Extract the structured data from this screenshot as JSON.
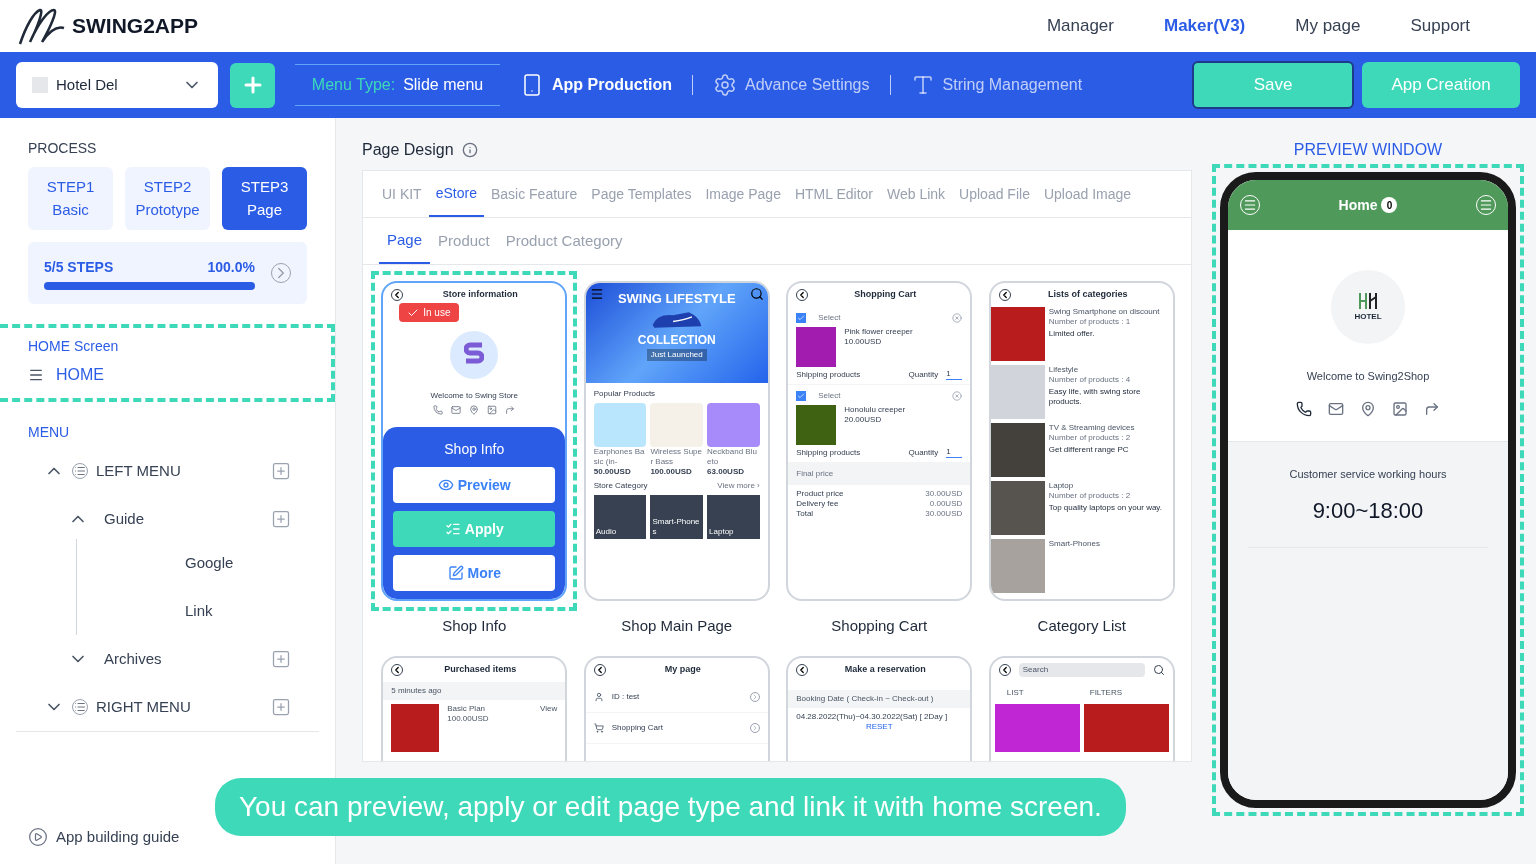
{
  "header": {
    "brand": "SWING2APP",
    "nav": [
      {
        "label": "Manager",
        "selected": false
      },
      {
        "label": "Maker(V3)",
        "selected": true
      },
      {
        "label": "My page",
        "selected": false
      },
      {
        "label": "Support",
        "selected": false
      }
    ]
  },
  "toolbar": {
    "project": "Hotel Del",
    "menu_type_label": "Menu Type:",
    "menu_type_value": "Slide menu",
    "tools": [
      {
        "kind": "production",
        "label": "App Production",
        "selected": true
      },
      {
        "kind": "settings",
        "label": "Advance Settings",
        "selected": false
      },
      {
        "kind": "strings",
        "label": "String Management",
        "selected": false
      }
    ],
    "save": "Save",
    "create": "App Creation"
  },
  "sidebar": {
    "process_title": "PROCESS",
    "steps": [
      {
        "line1": "STEP1",
        "line2": "Basic",
        "selected": false
      },
      {
        "line1": "STEP2",
        "line2": "Prototype",
        "selected": false
      },
      {
        "line1": "STEP3",
        "line2": "Page",
        "selected": true
      }
    ],
    "progress": {
      "label": "5/5 STEPS",
      "percent": "100.0%",
      "level": 1
    },
    "home_title": "HOME Screen",
    "home_item": "HOME",
    "menu_title": "MENU",
    "tree": [
      {
        "label": "LEFT MENU",
        "expanded": true,
        "children": [
          {
            "label": "Guide",
            "expanded": true,
            "children": [
              {
                "label": "Google"
              },
              {
                "label": "Link"
              }
            ]
          },
          {
            "label": "Archives",
            "expanded": false
          }
        ]
      },
      {
        "label": "RIGHT MENU",
        "expanded": false
      }
    ],
    "guide": "App building guide"
  },
  "main": {
    "title": "Page Design",
    "tabs": [
      {
        "label": "UI KIT",
        "selected": false
      },
      {
        "label": "eStore",
        "selected": true
      },
      {
        "label": "Basic Feature",
        "selected": false
      },
      {
        "label": "Page Templates",
        "selected": false
      },
      {
        "label": "Image Page",
        "selected": false
      },
      {
        "label": "HTML Editor",
        "selected": false
      },
      {
        "label": "Web Link",
        "selected": false
      },
      {
        "label": "Upload File",
        "selected": false
      },
      {
        "label": "Upload Image",
        "selected": false
      }
    ],
    "subtabs": [
      {
        "label": "Page",
        "selected": true
      },
      {
        "label": "Product",
        "selected": false
      },
      {
        "label": "Product Category",
        "selected": false
      }
    ],
    "templates": [
      {
        "kind": "shop_info",
        "caption": "Shop Info",
        "selected": true,
        "in_use": true,
        "badge": "In use",
        "title": "Store information",
        "welcome": "Welcome to Swing Store",
        "overlay_title": "Shop Info",
        "actions": [
          "Preview",
          "Apply",
          "More"
        ]
      },
      {
        "kind": "main",
        "caption": "Shop Main Page",
        "selected": false,
        "in_use": false,
        "banner_title": "SWING LIFESTYLE",
        "banner_sub": "COLLECTION",
        "banner_note": "Just Launched",
        "section1": "Popular Products",
        "products": [
          {
            "name": "Earphones Basic (in-",
            "price": "50.00USD"
          },
          {
            "name": "Wireless Super Bass",
            "price": "100.00USD"
          },
          {
            "name": "Neckband Blueto",
            "price": "63.00USD"
          }
        ],
        "section2": "Store Category",
        "more": "View more ›",
        "categories": [
          "Audio",
          "Smart-Phones",
          "Laptop"
        ]
      },
      {
        "kind": "cart",
        "caption": "Shopping Cart",
        "selected": false,
        "in_use": false,
        "title": "Shopping Cart",
        "items": [
          {
            "select": "Select",
            "checked": true,
            "name": "Pink flower creeper",
            "price": "10.00USD",
            "group": "Shipping products",
            "qty_label": "Quantity",
            "qty": "1"
          },
          {
            "select": "Select",
            "checked": true,
            "name": "Honolulu creeper",
            "price": "20.00USD",
            "group": "Shipping products",
            "qty_label": "Quantity",
            "qty": "1"
          }
        ],
        "final": "Final price",
        "lines": [
          {
            "label": "Product price",
            "value": "30.00USD"
          },
          {
            "label": "Delivery fee",
            "value": "0.00USD"
          },
          {
            "label": "Total",
            "value": "30.00USD"
          }
        ]
      },
      {
        "kind": "categories",
        "caption": "Category List",
        "selected": false,
        "in_use": false,
        "title": "Lists of categories",
        "items": [
          {
            "name": "Swing Smartphone on discount",
            "count": "Number of products : 1",
            "desc": "Limited offer."
          },
          {
            "name": "Lifestyle",
            "count": "Number of products : 4",
            "desc": "Easy life, with swing store products."
          },
          {
            "name": "TV & Streaming devices",
            "count": "Number of products : 2",
            "desc": "Get different range PC"
          },
          {
            "name": "Laptop",
            "count": "Number of products : 2",
            "desc": "Top quality laptops on your way."
          },
          {
            "name": "Smart-Phones"
          }
        ]
      },
      {
        "kind": "purchased",
        "selected": false,
        "in_use": false,
        "title": "Purchased items",
        "time": "5 minutes ago",
        "item_name": "Basic Plan",
        "item_price": "100.00USD",
        "action": "View"
      },
      {
        "kind": "mypage",
        "selected": false,
        "in_use": false,
        "title": "My page",
        "rows": [
          "ID : test",
          "Shopping Cart"
        ]
      },
      {
        "kind": "reservation",
        "selected": false,
        "in_use": false,
        "title": "Make a reservation",
        "label": "Booking Date ( Check-in ~ Check-out )",
        "dates": "04.28.2022(Thu)~04.30.2022(Sat) [ 2Day ]",
        "reset": "RESET"
      },
      {
        "kind": "search",
        "selected": false,
        "in_use": false,
        "placeholder": "Search",
        "options": [
          "LIST",
          "FILTERS"
        ]
      }
    ]
  },
  "preview": {
    "title": "PREVIEW WINDOW",
    "header": "Home",
    "badge": "0",
    "logo": "HOTEL",
    "welcome": "Welcome to Swing2Shop",
    "hours_title": "Customer service working hours",
    "hours": "9:00~18:00"
  },
  "banner": "You can preview, apply or edit page type and link it with home screen."
}
